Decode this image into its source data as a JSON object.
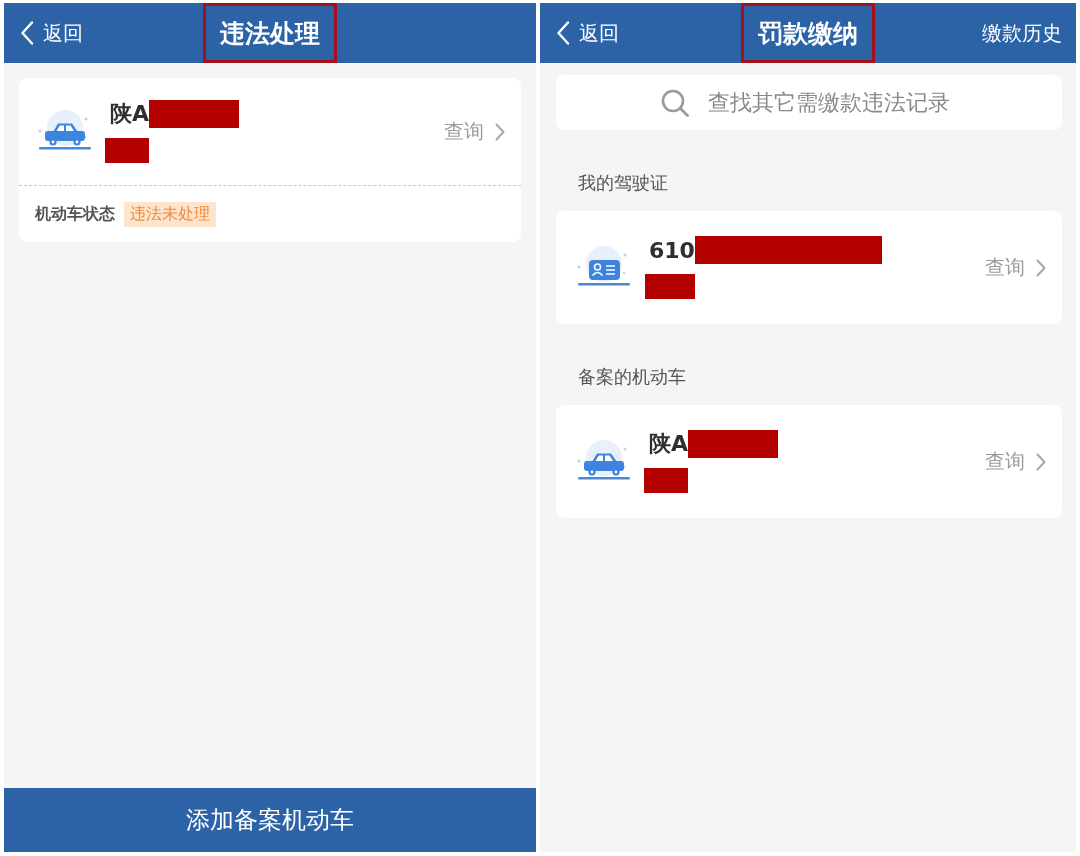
{
  "screens": [
    {
      "header": {
        "back": "返回",
        "title": "违法处理",
        "highlighted": true
      },
      "sections": [
        {
          "cards": [
            {
              "kind": "vehicle",
              "number": "陕A",
              "redacted": true,
              "action": "查询",
              "status": {
                "label": "机动车状态",
                "value": "违法未处理"
              }
            }
          ]
        }
      ],
      "footer_button": "添加备案机动车"
    },
    {
      "header": {
        "back": "返回",
        "title": "罚款缴纳",
        "highlighted": true,
        "action": "缴款历史"
      },
      "search": {
        "placeholder": "查找其它需缴款违法记录"
      },
      "sections": [
        {
          "heading": "我的驾驶证",
          "cards": [
            {
              "kind": "license",
              "number": "610",
              "redacted": true,
              "action": "查询"
            }
          ]
        },
        {
          "heading": "备案的机动车",
          "cards": [
            {
              "kind": "vehicle",
              "number": "陕A",
              "redacted": true,
              "action": "查询"
            }
          ]
        }
      ]
    }
  ]
}
